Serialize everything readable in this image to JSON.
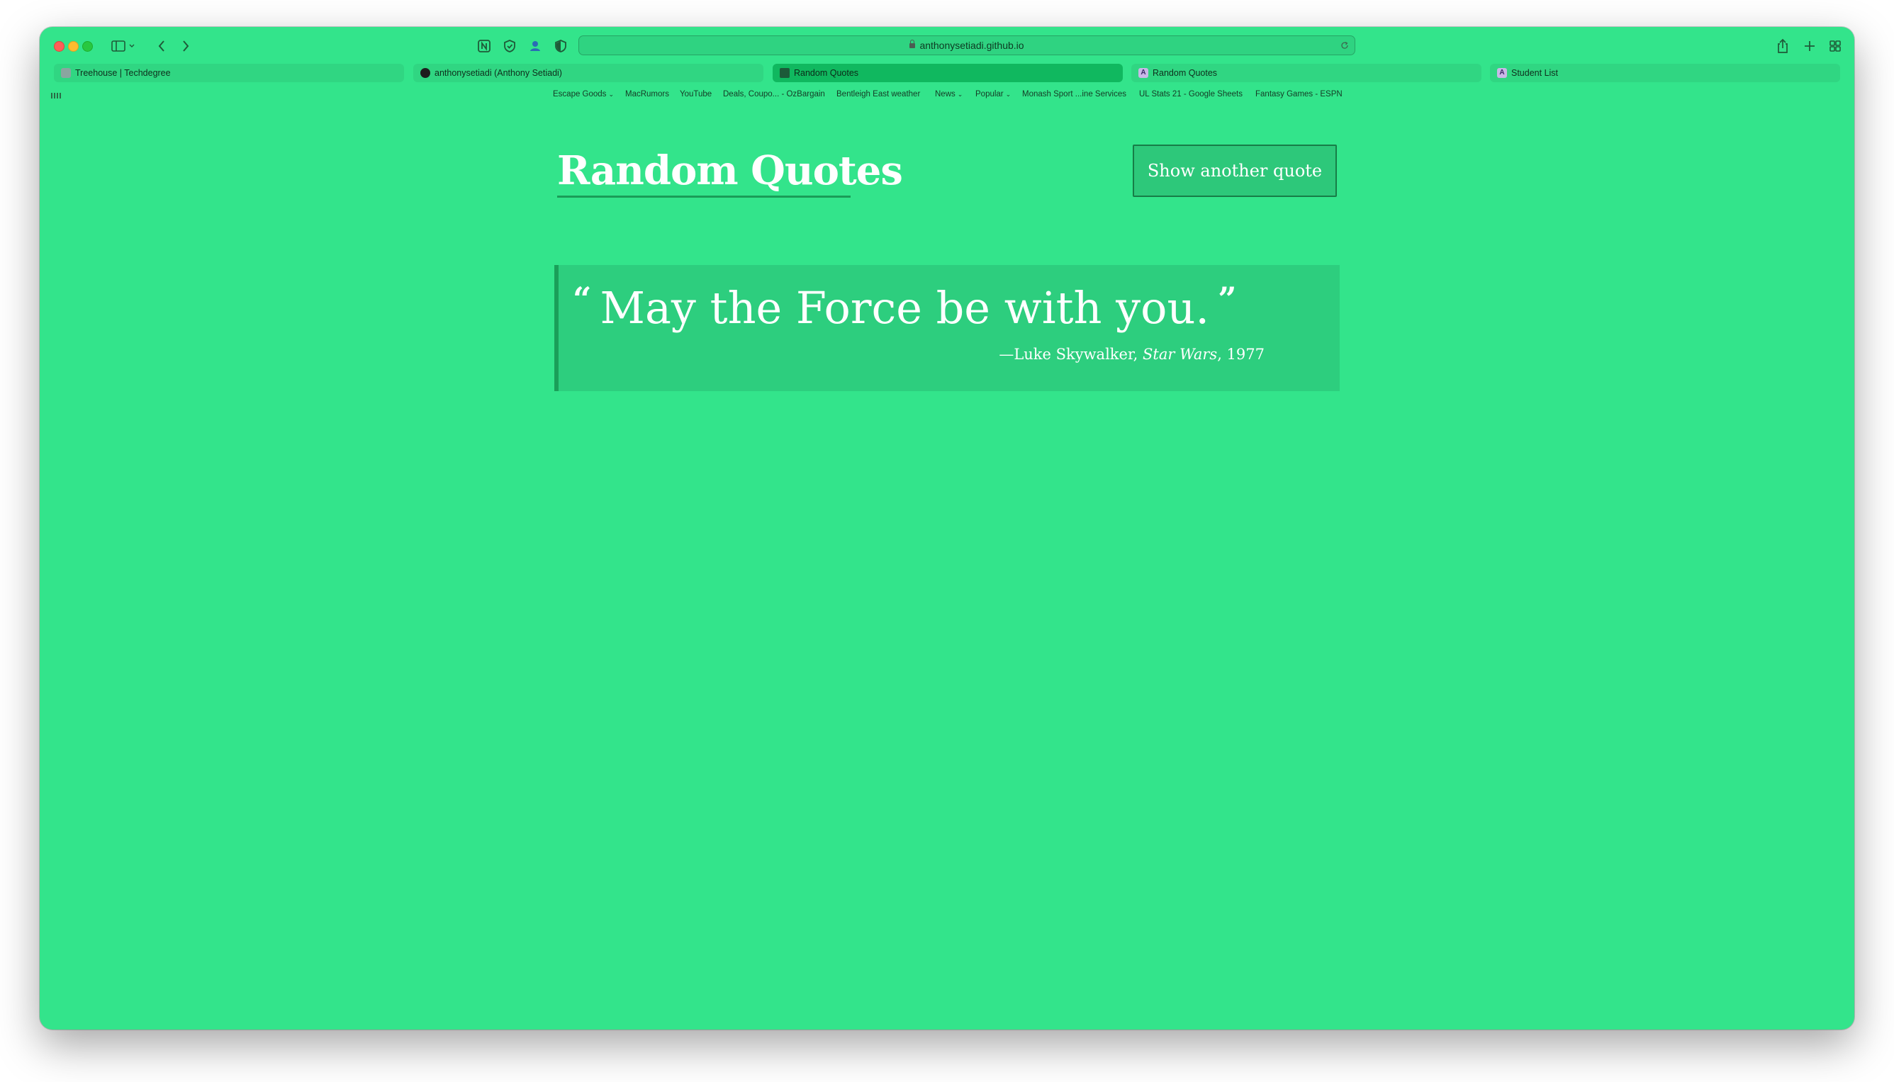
{
  "browser": {
    "url": "anthonysetiadi.github.io",
    "tabs": [
      {
        "label": "Treehouse | Techdegree"
      },
      {
        "label": "anthonysetiadi (Anthony Setiadi)"
      },
      {
        "label": "Random Quotes",
        "active": true
      },
      {
        "label": "Random Quotes"
      },
      {
        "label": "Student List"
      }
    ],
    "bookmarks": [
      {
        "label": "Escape Goods",
        "menu": true
      },
      {
        "label": "MacRumors"
      },
      {
        "label": "YouTube"
      },
      {
        "label": "Deals, Coupo... - OzBargain"
      },
      {
        "label": "Bentleigh East weather"
      },
      {
        "label": "News",
        "menu": true
      },
      {
        "label": "Popular",
        "menu": true
      },
      {
        "label": "Monash Sport ...ine Services"
      },
      {
        "label": "UL Stats 21 - Google Sheets"
      },
      {
        "label": "Fantasy Games - ESPN"
      }
    ]
  },
  "page": {
    "title": "Random Quotes",
    "button_label": "Show another quote",
    "quote": {
      "open_mark": "“",
      "text": "May the Force be with you.",
      "close_mark": "”",
      "source": "—Luke Skywalker,",
      "citation": "Star Wars",
      "year": ", 1977"
    },
    "background_color": "#33e48b"
  }
}
